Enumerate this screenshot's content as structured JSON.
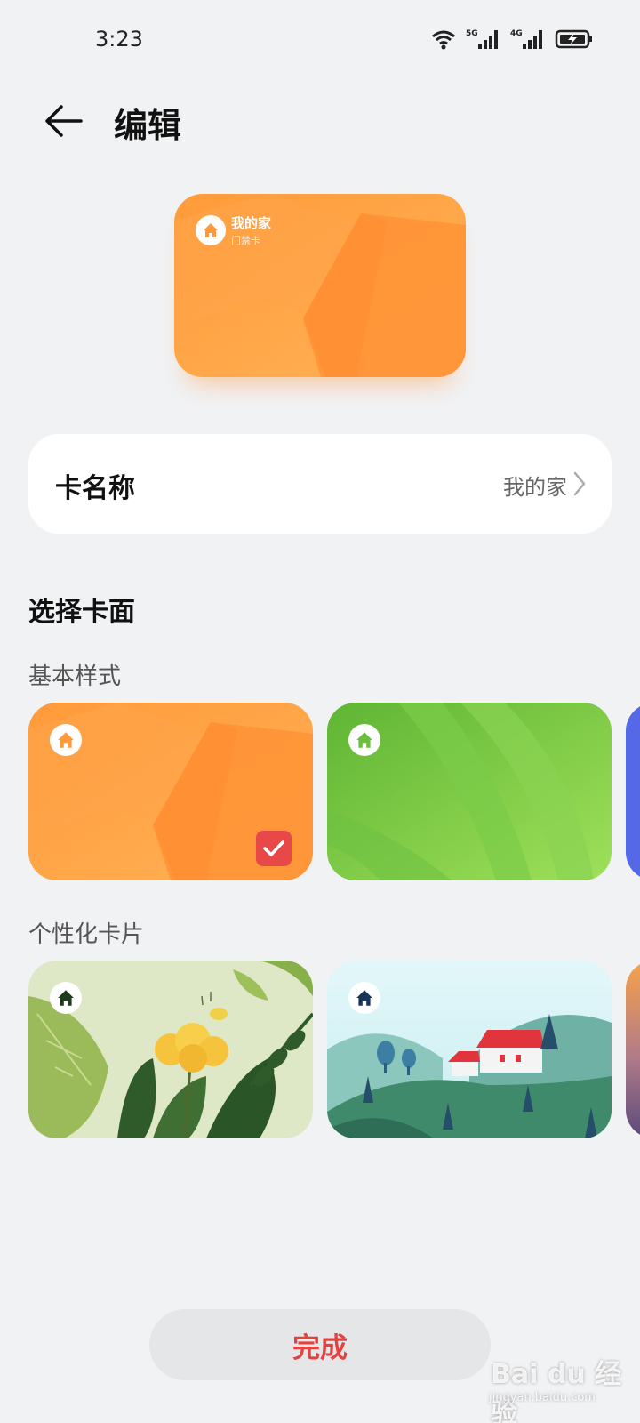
{
  "status_bar": {
    "time": "3:23",
    "net1": "5G",
    "net2": "4G",
    "icons": [
      "wifi-icon",
      "signal-5g-icon",
      "signal-4g-icon",
      "battery-charging-icon"
    ]
  },
  "header": {
    "title": "编辑",
    "back_icon": "arrow-left-icon"
  },
  "preview_card": {
    "title": "我的家",
    "subtitle": "门禁卡",
    "icon": "home-icon",
    "color": "#ff9a3c"
  },
  "name_row": {
    "label": "卡名称",
    "value": "我的家"
  },
  "section": {
    "title": "选择卡面"
  },
  "basic": {
    "label": "基本样式",
    "cards": [
      {
        "name": "orange",
        "selected": true,
        "color": "#ff9a3c"
      },
      {
        "name": "green",
        "selected": false,
        "color": "#6cbf3c"
      },
      {
        "name": "blue",
        "selected": false,
        "color": "#5468e8"
      }
    ]
  },
  "personal": {
    "label": "个性化卡片",
    "cards": [
      {
        "name": "flower-leaves"
      },
      {
        "name": "hills-house"
      },
      {
        "name": "sunset-mountains"
      }
    ]
  },
  "done_button": {
    "label": "完成",
    "color": "#e3433f"
  },
  "watermark": {
    "main": "Bai du 经验",
    "sub": "jingyan.baidu.com"
  }
}
